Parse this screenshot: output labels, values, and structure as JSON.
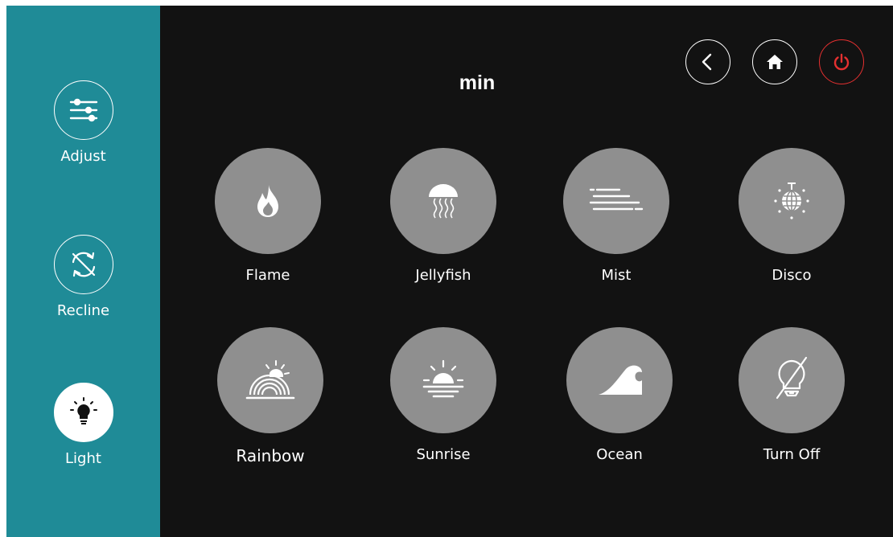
{
  "screen_title": "min",
  "colors": {
    "sidebar": "#1f8b97",
    "background": "#121212",
    "tile": "#8f8f8f",
    "power": "#e53030"
  },
  "sidebar": {
    "items": [
      {
        "label": "Adjust",
        "icon": "sliders-icon"
      },
      {
        "label": "Recline",
        "icon": "recline-cycle-icon"
      },
      {
        "label": "Light",
        "icon": "light-bulb-icon",
        "active": true
      }
    ]
  },
  "topbar": {
    "buttons": [
      {
        "name": "back",
        "icon": "chevron-left-icon"
      },
      {
        "name": "home",
        "icon": "home-icon"
      },
      {
        "name": "power",
        "icon": "power-icon"
      }
    ]
  },
  "modes": [
    {
      "label": "Flame",
      "icon": "flame-icon"
    },
    {
      "label": "Jellyfish",
      "icon": "jellyfish-icon"
    },
    {
      "label": "Mist",
      "icon": "mist-icon"
    },
    {
      "label": "Disco",
      "icon": "disco-ball-icon"
    },
    {
      "label": "Rainbow",
      "icon": "rainbow-icon"
    },
    {
      "label": "Sunrise",
      "icon": "sunrise-icon"
    },
    {
      "label": "Ocean",
      "icon": "wave-icon"
    },
    {
      "label": "Turn Off",
      "icon": "light-off-icon"
    }
  ]
}
